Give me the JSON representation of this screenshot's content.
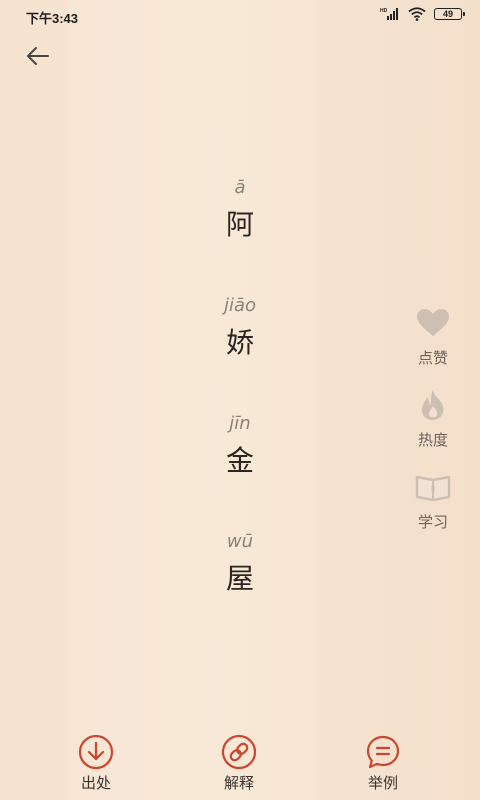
{
  "status_bar": {
    "time": "下午3:43",
    "battery": "49"
  },
  "words": [
    {
      "pinyin": "ā",
      "hanzi": "阿"
    },
    {
      "pinyin": "jiāo",
      "hanzi": "娇"
    },
    {
      "pinyin": "jīn",
      "hanzi": "金"
    },
    {
      "pinyin": "wū",
      "hanzi": "屋"
    }
  ],
  "side_actions": {
    "like": "点赞",
    "heat": "热度",
    "learn": "学习"
  },
  "bottom_nav": {
    "source": "出处",
    "explain": "解释",
    "example": "举例"
  },
  "colors": {
    "accent": "#c9472f",
    "side_icon": "#cdbfb2",
    "text": "#2b2622"
  },
  "icons": {
    "back": "arrow-left-icon",
    "like": "heart-icon",
    "heat": "flame-icon",
    "learn": "book-icon",
    "source": "download-circle-icon",
    "explain": "link-circle-icon",
    "example": "chat-bubble-icon"
  }
}
